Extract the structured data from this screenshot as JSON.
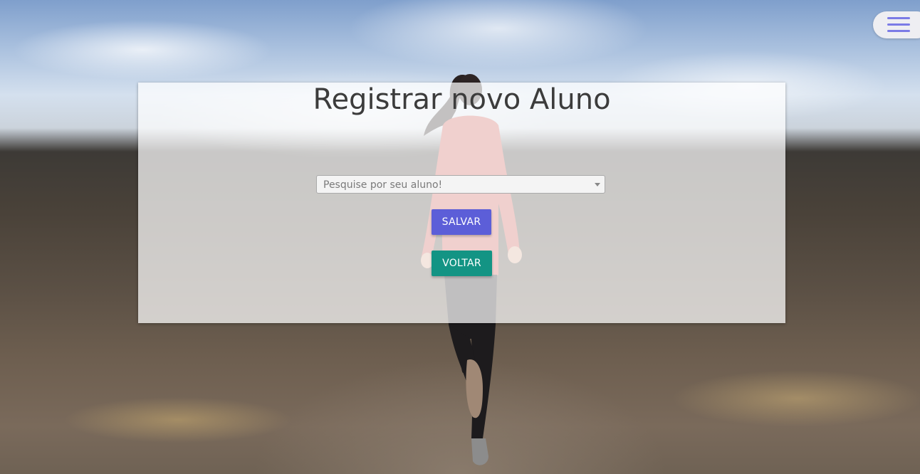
{
  "menu": {
    "icon": "hamburger-icon"
  },
  "form": {
    "title": "Registrar novo Aluno",
    "student_select": {
      "placeholder": "Pesquise por seu aluno!",
      "icon": "dropdown-arrow-icon"
    },
    "save_label": "SALVAR",
    "back_label": "VOLTAR"
  },
  "colors": {
    "save_button": "#5c5ed8",
    "back_button": "#139484",
    "menu_icon": "#7b7be6"
  }
}
